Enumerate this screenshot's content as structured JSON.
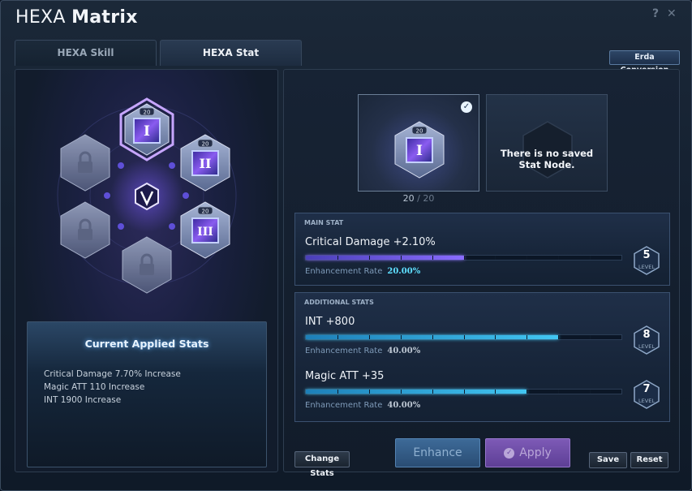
{
  "window": {
    "title_light": "HEXA",
    "title_bold": "Matrix",
    "help_icon": "question-mark-icon",
    "close_icon": "close-icon"
  },
  "tabs": [
    {
      "label": "HEXA Skill",
      "active": false
    },
    {
      "label": "HEXA Stat",
      "active": true
    }
  ],
  "erda_conversion_label": "Erda Conversion",
  "hex_grid": {
    "center_icon": "v-emblem-icon",
    "nodes": [
      {
        "name": "node-1",
        "level": "20",
        "numeral": "I",
        "locked": false,
        "selected": true
      },
      {
        "name": "node-2",
        "level": "20",
        "numeral": "II",
        "locked": false,
        "selected": false
      },
      {
        "name": "node-3",
        "level": "20",
        "numeral": "III",
        "locked": false,
        "selected": false
      },
      {
        "name": "node-locked-1",
        "locked": true
      },
      {
        "name": "node-locked-2",
        "locked": true
      },
      {
        "name": "node-locked-3",
        "locked": true
      }
    ]
  },
  "current_stats": {
    "title": "Current Applied Stats",
    "lines": [
      "Critical Damage 7.70% Increase",
      "Magic ATT 110 Increase",
      "INT 1900 Increase"
    ]
  },
  "saved_node": {
    "level_badge": "20",
    "numeral": "I",
    "level_current": "20",
    "level_max": "20",
    "empty_text_1": "There is no saved",
    "empty_text_2": "Stat Node."
  },
  "main_stat": {
    "section_label": "MAIN STAT",
    "name": "Critical Damage +2.10%",
    "progress": 0.5,
    "rate_label": "Enhancement Rate",
    "rate_value": "20.00%",
    "level": "5",
    "level_word": "LEVEL"
  },
  "additional_stats": {
    "section_label": "ADDITIONAL STATS",
    "items": [
      {
        "name": "INT +800",
        "progress": 0.8,
        "rate_label": "Enhancement Rate",
        "rate_value": "40.00%",
        "level": "8",
        "level_word": "LEVEL"
      },
      {
        "name": "Magic ATT +35",
        "progress": 0.7,
        "rate_label": "Enhancement Rate",
        "rate_value": "40.00%",
        "level": "7",
        "level_word": "LEVEL"
      }
    ]
  },
  "buttons": {
    "change_stats": "Change Stats",
    "enhance": "Enhance",
    "apply": "Apply",
    "save": "Save",
    "reset": "Reset"
  },
  "colors": {
    "main_bar": "#8a6cff",
    "additional_bar": "#42c6f2",
    "highlight_rate": "#5fe0ff"
  }
}
